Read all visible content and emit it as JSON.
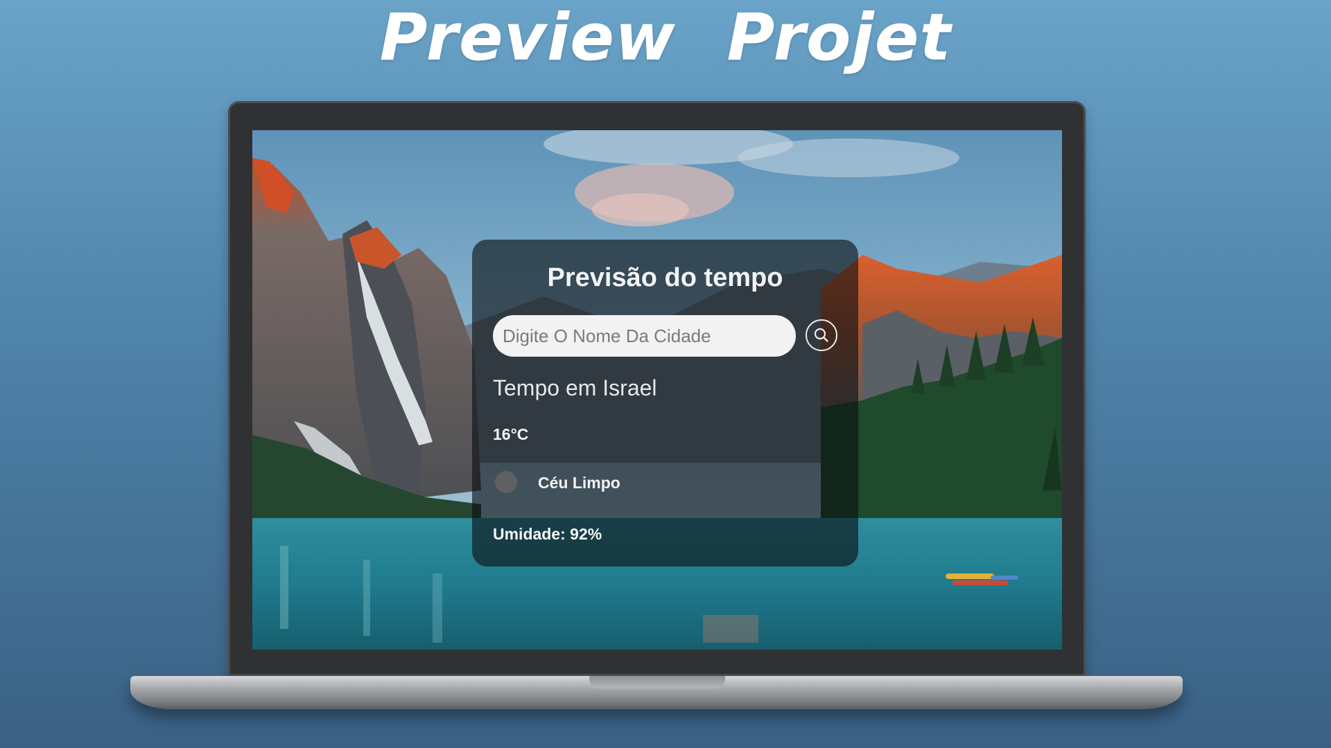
{
  "banner": {
    "title": "Preview  Projet"
  },
  "weather_app": {
    "title": "Previsão do tempo",
    "search": {
      "placeholder": "Digite O Nome Da Cidade",
      "value": "",
      "button_icon": "search-icon"
    },
    "city_heading": "Tempo em Israel",
    "temperature": "16°C",
    "condition": {
      "icon": "weather-condition-icon",
      "text": "Céu Limpo"
    },
    "humidity": "Umidade: 92%"
  },
  "colors": {
    "page_background": "#4f83a9",
    "card_background": "#0c0e11",
    "input_background": "#f2f2f2",
    "text": "#ffffff"
  }
}
